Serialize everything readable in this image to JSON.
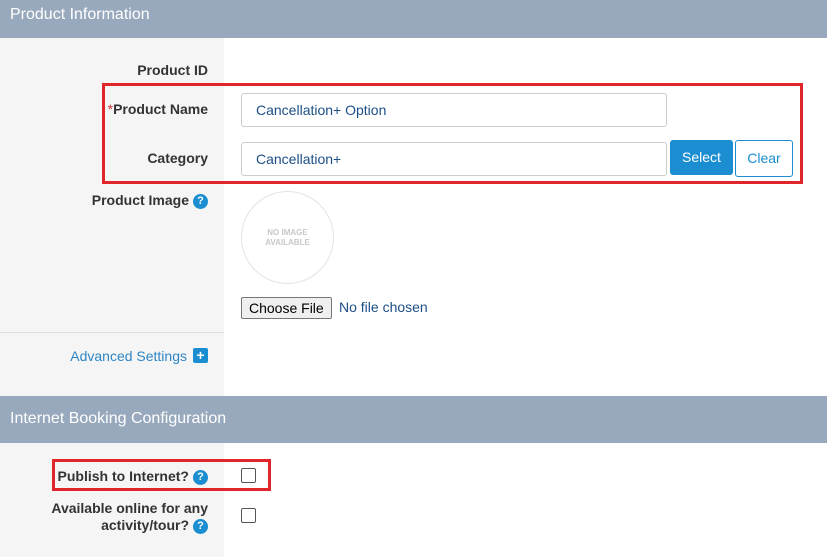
{
  "product_info": {
    "title": "Product Information",
    "product_id_label": "Product ID",
    "product_name_required": "*",
    "product_name_label": "Product Name",
    "product_name_value": "Cancellation+ Option",
    "category_label": "Category",
    "category_value": "Cancellation+",
    "select_label": "Select",
    "clear_label": "Clear",
    "product_image_label": "Product Image",
    "no_image_line1": "NO IMAGE",
    "no_image_line2": "AVAILABLE",
    "choose_file_label": "Choose File",
    "no_file_label": "No file chosen",
    "advanced_settings_label": "Advanced Settings"
  },
  "booking": {
    "title": "Internet Booking Configuration",
    "publish_label": "Publish to Internet?",
    "publish_checked": false,
    "available_label_line1": "Available online for any",
    "available_label_line2": "activity/tour?",
    "available_checked": false
  },
  "colors": {
    "header_bg": "#98a9bd",
    "accent": "#1a8ed0",
    "highlight": "#e0252b"
  },
  "icons": {
    "help": "question-circle-icon",
    "plus": "plus-square-icon"
  }
}
